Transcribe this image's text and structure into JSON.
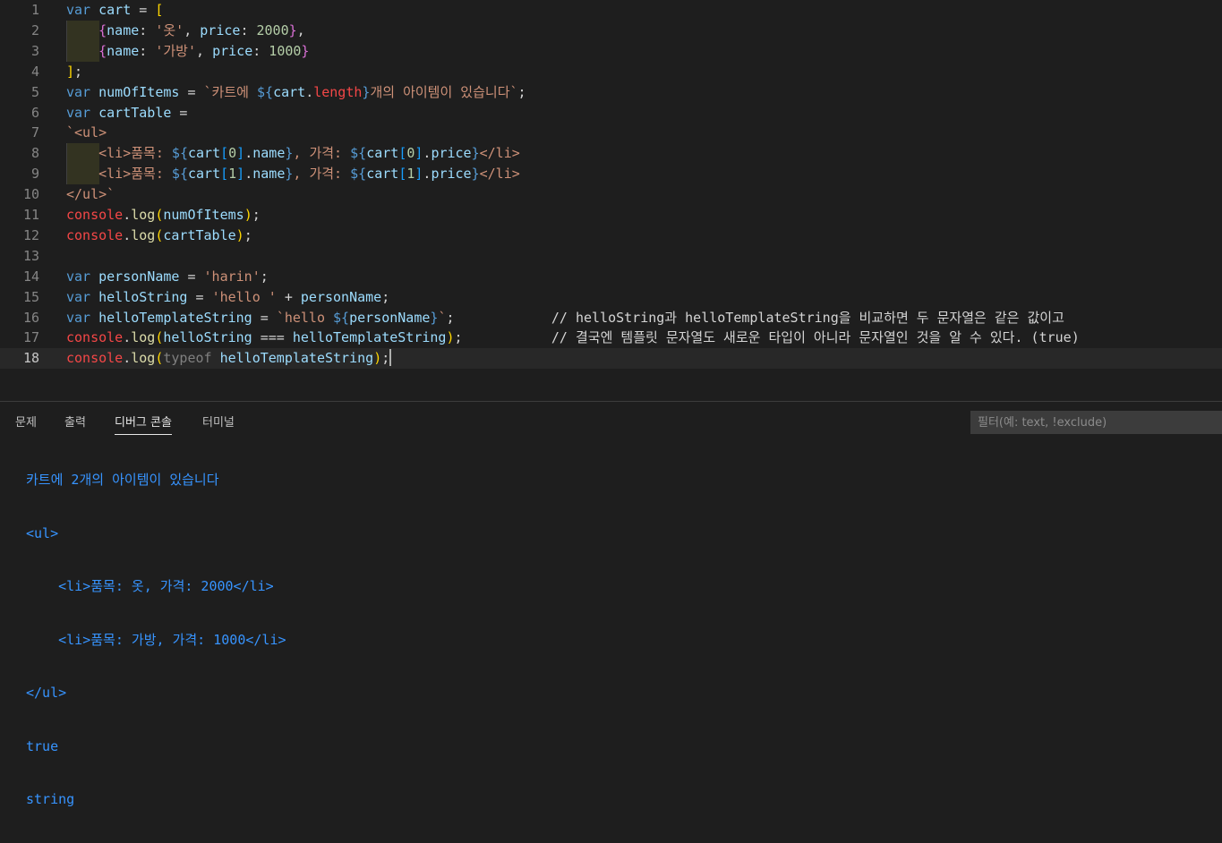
{
  "editor": {
    "lines": [
      {
        "n": "1",
        "tokens": [
          [
            "kw",
            "var"
          ],
          [
            "op",
            " "
          ],
          [
            "v",
            "cart"
          ],
          [
            "op",
            " = "
          ],
          [
            "br1",
            "["
          ]
        ]
      },
      {
        "n": "2",
        "guide": true,
        "tokens": [
          [
            "op",
            "    "
          ],
          [
            "br2",
            "{"
          ],
          [
            "v",
            "name"
          ],
          [
            "op",
            ": "
          ],
          [
            "str",
            "'옷'"
          ],
          [
            "op",
            ", "
          ],
          [
            "v",
            "price"
          ],
          [
            "op",
            ": "
          ],
          [
            "num",
            "2000"
          ],
          [
            "br2",
            "}"
          ],
          [
            "op",
            ","
          ]
        ]
      },
      {
        "n": "3",
        "guide": true,
        "tokens": [
          [
            "op",
            "    "
          ],
          [
            "br2",
            "{"
          ],
          [
            "v",
            "name"
          ],
          [
            "op",
            ": "
          ],
          [
            "str",
            "'가방'"
          ],
          [
            "op",
            ", "
          ],
          [
            "v",
            "price"
          ],
          [
            "op",
            ": "
          ],
          [
            "num",
            "1000"
          ],
          [
            "br2",
            "}"
          ]
        ]
      },
      {
        "n": "4",
        "tokens": [
          [
            "br1",
            "]"
          ],
          [
            "op",
            ";"
          ]
        ]
      },
      {
        "n": "5",
        "tokens": [
          [
            "kw",
            "var"
          ],
          [
            "op",
            " "
          ],
          [
            "v",
            "numOfItems"
          ],
          [
            "op",
            " = "
          ],
          [
            "str",
            "`카트에 "
          ],
          [
            "tplb",
            "${"
          ],
          [
            "v",
            "cart"
          ],
          [
            "op",
            "."
          ],
          [
            "len",
            "length"
          ],
          [
            "tplb",
            "}"
          ],
          [
            "str",
            "개의 아이템이 있습니다`"
          ],
          [
            "op",
            ";"
          ]
        ]
      },
      {
        "n": "6",
        "tokens": [
          [
            "kw",
            "var"
          ],
          [
            "op",
            " "
          ],
          [
            "v",
            "cartTable"
          ],
          [
            "op",
            " ="
          ]
        ]
      },
      {
        "n": "7",
        "tokens": [
          [
            "str",
            "`<ul>"
          ]
        ]
      },
      {
        "n": "8",
        "guide": true,
        "tokens": [
          [
            "op",
            "    "
          ],
          [
            "str",
            "<li>품목: "
          ],
          [
            "tplb",
            "${"
          ],
          [
            "v",
            "cart"
          ],
          [
            "br3",
            "["
          ],
          [
            "num",
            "0"
          ],
          [
            "br3",
            "]"
          ],
          [
            "op",
            "."
          ],
          [
            "v",
            "name"
          ],
          [
            "tplb",
            "}"
          ],
          [
            "str",
            ", 가격: "
          ],
          [
            "tplb",
            "${"
          ],
          [
            "v",
            "cart"
          ],
          [
            "br3",
            "["
          ],
          [
            "num",
            "0"
          ],
          [
            "br3",
            "]"
          ],
          [
            "op",
            "."
          ],
          [
            "v",
            "price"
          ],
          [
            "tplb",
            "}"
          ],
          [
            "str",
            "</li>"
          ]
        ]
      },
      {
        "n": "9",
        "guide": true,
        "tokens": [
          [
            "op",
            "    "
          ],
          [
            "str",
            "<li>품목: "
          ],
          [
            "tplb",
            "${"
          ],
          [
            "v",
            "cart"
          ],
          [
            "br3",
            "["
          ],
          [
            "num",
            "1"
          ],
          [
            "br3",
            "]"
          ],
          [
            "op",
            "."
          ],
          [
            "v",
            "name"
          ],
          [
            "tplb",
            "}"
          ],
          [
            "str",
            ", 가격: "
          ],
          [
            "tplb",
            "${"
          ],
          [
            "v",
            "cart"
          ],
          [
            "br3",
            "["
          ],
          [
            "num",
            "1"
          ],
          [
            "br3",
            "]"
          ],
          [
            "op",
            "."
          ],
          [
            "v",
            "price"
          ],
          [
            "tplb",
            "}"
          ],
          [
            "str",
            "</li>"
          ]
        ]
      },
      {
        "n": "10",
        "tokens": [
          [
            "str",
            "</ul>`"
          ]
        ]
      },
      {
        "n": "11",
        "tokens": [
          [
            "obj",
            "console"
          ],
          [
            "op",
            "."
          ],
          [
            "fn",
            "log"
          ],
          [
            "br1",
            "("
          ],
          [
            "v",
            "numOfItems"
          ],
          [
            "br1",
            ")"
          ],
          [
            "op",
            ";"
          ]
        ]
      },
      {
        "n": "12",
        "tokens": [
          [
            "obj",
            "console"
          ],
          [
            "op",
            "."
          ],
          [
            "fn",
            "log"
          ],
          [
            "br1",
            "("
          ],
          [
            "v",
            "cartTable"
          ],
          [
            "br1",
            ")"
          ],
          [
            "op",
            ";"
          ]
        ]
      },
      {
        "n": "13",
        "tokens": []
      },
      {
        "n": "14",
        "tokens": [
          [
            "kw",
            "var"
          ],
          [
            "op",
            " "
          ],
          [
            "v",
            "personName"
          ],
          [
            "op",
            " = "
          ],
          [
            "str",
            "'harin'"
          ],
          [
            "op",
            ";"
          ]
        ]
      },
      {
        "n": "15",
        "tokens": [
          [
            "kw",
            "var"
          ],
          [
            "op",
            " "
          ],
          [
            "v",
            "helloString"
          ],
          [
            "op",
            " = "
          ],
          [
            "str",
            "'hello '"
          ],
          [
            "op",
            " + "
          ],
          [
            "v",
            "personName"
          ],
          [
            "op",
            ";"
          ]
        ]
      },
      {
        "n": "16",
        "tokens": [
          [
            "kw",
            "var"
          ],
          [
            "op",
            " "
          ],
          [
            "v",
            "helloTemplateString"
          ],
          [
            "op",
            " = "
          ],
          [
            "str",
            "`hello "
          ],
          [
            "tplb",
            "${"
          ],
          [
            "v",
            "personName"
          ],
          [
            "tplb",
            "}"
          ],
          [
            "str",
            "`"
          ],
          [
            "op",
            ";            "
          ],
          [
            "cmt",
            "// helloString과 helloTemplateString을 비교하면 두 문자열은 같은 값이고"
          ]
        ]
      },
      {
        "n": "17",
        "tokens": [
          [
            "obj",
            "console"
          ],
          [
            "op",
            "."
          ],
          [
            "fn",
            "log"
          ],
          [
            "br1",
            "("
          ],
          [
            "v",
            "helloString"
          ],
          [
            "op",
            " === "
          ],
          [
            "v",
            "helloTemplateString"
          ],
          [
            "br1",
            ")"
          ],
          [
            "op",
            ";           "
          ],
          [
            "cmt",
            "// 결국엔 템플릿 문자열도 새로운 타입이 아니라 문자열인 것을 알 수 있다. (true)"
          ]
        ]
      },
      {
        "n": "18",
        "current": true,
        "tokens": [
          [
            "obj",
            "console"
          ],
          [
            "op",
            "."
          ],
          [
            "fn",
            "log"
          ],
          [
            "br1",
            "("
          ],
          [
            "typeof",
            "typeof"
          ],
          [
            "op",
            " "
          ],
          [
            "v",
            "helloTemplateString"
          ],
          [
            "br1",
            ")"
          ],
          [
            "op",
            ";"
          ]
        ]
      }
    ]
  },
  "panel": {
    "tabs": [
      "문제",
      "출력",
      "디버그 콘솔",
      "터미널"
    ],
    "active_tab": "디버그 콘솔",
    "filter_placeholder": "필터(예: text, !exclude)",
    "console_output": [
      "카트에 2개의 아이템이 있습니다",
      "<ul>",
      "    <li>품목: 옷, 가격: 2000</li>",
      "    <li>품목: 가방, 가격: 1000</li>",
      "</ul>",
      "true",
      "string"
    ]
  }
}
